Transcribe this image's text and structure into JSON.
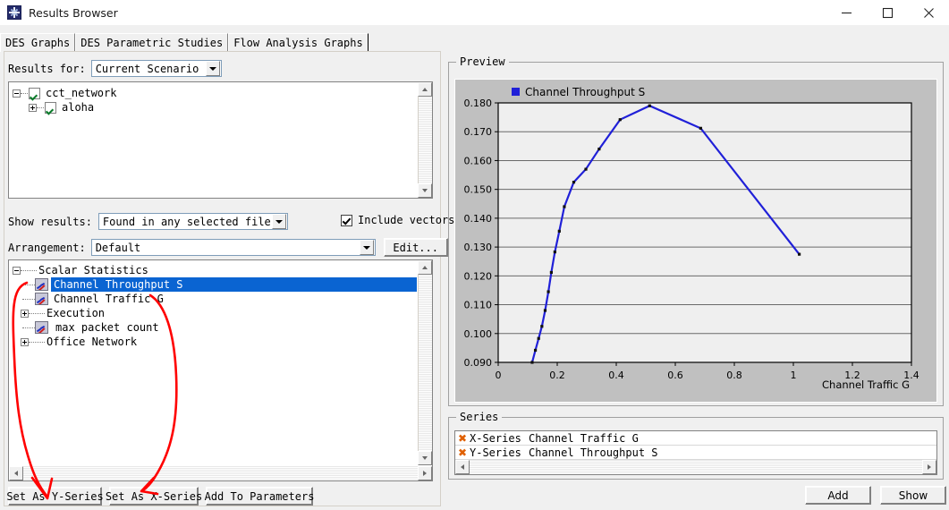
{
  "window": {
    "title": "Results Browser",
    "icon": "app-starburst-icon",
    "minimize_label": "—",
    "maximize_label": "□",
    "close_label": "✕"
  },
  "tabs": [
    {
      "label": "DES Graphs",
      "selected": false
    },
    {
      "label": "DES Parametric Studies",
      "selected": true
    },
    {
      "label": "Flow Analysis Graphs",
      "selected": false
    }
  ],
  "left": {
    "results_for_label": "Results for:",
    "results_for_value": "Current Scenario",
    "scenario_tree": [
      {
        "label": "cct_network",
        "indent": 0,
        "expander": "minus",
        "checked": true
      },
      {
        "label": "aloha",
        "indent": 1,
        "expander": "plus",
        "checked": true
      }
    ],
    "show_results_label": "Show results:",
    "show_results_value": "Found in any selected files",
    "include_vectors_label": "Include vectors",
    "include_vectors_checked": true,
    "arrangement_label": "Arrangement:",
    "arrangement_value": "Default",
    "edit_button": "Edit...",
    "stats_tree": [
      {
        "label": "Scalar Statistics",
        "indent": 0,
        "kind": "folder",
        "expander": "minus",
        "selected": false
      },
      {
        "label": "Channel Throughput S",
        "indent": 1,
        "kind": "stat",
        "expander": "none",
        "selected": true
      },
      {
        "label": "Channel Traffic G",
        "indent": 1,
        "kind": "stat",
        "expander": "none",
        "selected": false
      },
      {
        "label": "Execution",
        "indent": 0,
        "kind": "folder",
        "expander": "plus",
        "selected": false
      },
      {
        "label": "max packet count",
        "indent": 1,
        "kind": "stat",
        "expander": "none",
        "selected": false
      },
      {
        "label": "Office Network",
        "indent": 0,
        "kind": "folder",
        "expander": "plus",
        "selected": false
      }
    ],
    "buttons": [
      {
        "label": "Set As Y-Series",
        "mnemonic": "A"
      },
      {
        "label": "Set As X-Series",
        "mnemonic": "A"
      },
      {
        "label": "Add To Parameters",
        "mnemonic": "A"
      }
    ]
  },
  "right": {
    "preview_group_label": "Preview",
    "series_group_label": "Series",
    "series_rows": [
      {
        "role": "X-Series",
        "name": "Channel Traffic G",
        "remove_icon": "remove-x-icon"
      },
      {
        "role": "Y-Series",
        "name": "Channel Throughput S",
        "remove_icon": "remove-x-icon"
      }
    ],
    "add_button": "Add",
    "show_button": "Show"
  },
  "colors": {
    "series_blue": "#2020d8",
    "selection_blue": "#0a64d2",
    "annotation_red": "#ff0000",
    "plot_bg": "#efefef",
    "chart_bg": "#c0c0c0",
    "dialog_bg": "#f0f0f0",
    "remove_orange": "#e06000"
  },
  "annotations": {
    "arrow_to_y_series": "hand-drawn red arrow from Channel Throughput S to Set As Y-Series",
    "arrow_to_x_series": "hand-drawn red arrow from Channel Traffic G to Set As X-Series"
  },
  "chart_data": {
    "type": "line",
    "title": "",
    "legend": [
      "Channel Throughput S"
    ],
    "legend_position": "top-left",
    "xlabel": "Channel Traffic G",
    "ylabel": "",
    "xlim": [
      0,
      1.4
    ],
    "ylim": [
      0.09,
      0.18
    ],
    "xticks": [
      0,
      0.2,
      0.4,
      0.6,
      0.8,
      1,
      1.2,
      1.4
    ],
    "xtick_labels": [
      "0",
      "0.2",
      "0.4",
      "0.6",
      "0.8",
      "1",
      "1.2",
      "1.4"
    ],
    "yticks": [
      0.09,
      0.1,
      0.11,
      0.12,
      0.13,
      0.14,
      0.15,
      0.16,
      0.17,
      0.18
    ],
    "ytick_labels": [
      "0.090",
      "0.100",
      "0.110",
      "0.120",
      "0.130",
      "0.140",
      "0.150",
      "0.160",
      "0.170",
      "0.180"
    ],
    "grid": "horizontal",
    "series": [
      {
        "name": "Channel Throughput S",
        "color": "#2020d8",
        "marker": "square",
        "x": [
          0.115,
          0.126,
          0.137,
          0.148,
          0.159,
          0.17,
          0.18,
          0.192,
          0.207,
          0.224,
          0.256,
          0.297,
          0.342,
          0.413,
          0.513,
          0.686,
          1.02
        ],
        "y": [
          0.09,
          0.0942,
          0.0983,
          0.1025,
          0.108,
          0.1145,
          0.1212,
          0.1283,
          0.1355,
          0.144,
          0.1525,
          0.157,
          0.164,
          0.1742,
          0.179,
          0.1712,
          0.1275
        ]
      }
    ]
  }
}
